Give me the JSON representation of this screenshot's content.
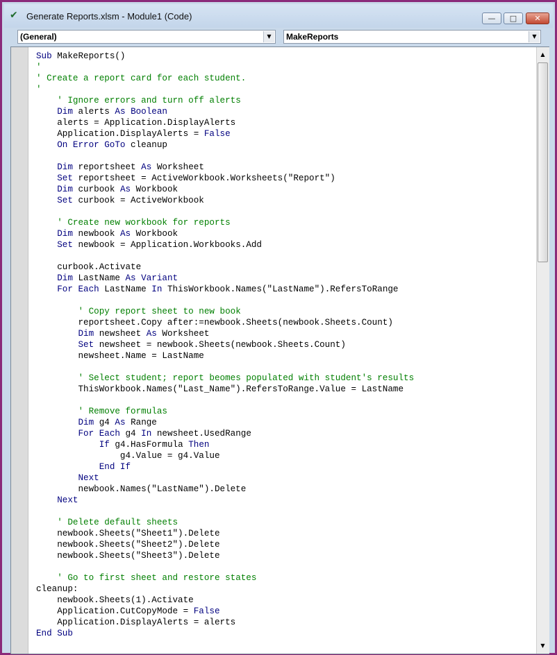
{
  "window": {
    "title": "Generate Reports.xlsm - Module1 (Code)",
    "icon": "excel-vba-icon",
    "controls": {
      "minimize": "—",
      "maximize": "□",
      "close": "✕"
    }
  },
  "object_combo": {
    "value": "(General)",
    "arrow": "▼"
  },
  "procedure_combo": {
    "value": "MakeReports",
    "arrow": "▼"
  },
  "scrollbar": {
    "up": "▲",
    "down": "▼"
  },
  "code_lines": [
    {
      "parts": [
        {
          "t": "kw",
          "s": "Sub"
        },
        {
          "t": "n",
          "s": " MakeReports()"
        }
      ]
    },
    {
      "parts": [
        {
          "t": "cm",
          "s": "'"
        }
      ]
    },
    {
      "parts": [
        {
          "t": "cm",
          "s": "' Create a report card for each student."
        }
      ]
    },
    {
      "parts": [
        {
          "t": "cm",
          "s": "'"
        }
      ]
    },
    {
      "parts": [
        {
          "t": "n",
          "s": "    "
        },
        {
          "t": "cm",
          "s": "' Ignore errors and turn off alerts"
        }
      ]
    },
    {
      "parts": [
        {
          "t": "n",
          "s": "    "
        },
        {
          "t": "kw",
          "s": "Dim"
        },
        {
          "t": "n",
          "s": " alerts "
        },
        {
          "t": "kw",
          "s": "As Boolean"
        }
      ]
    },
    {
      "parts": [
        {
          "t": "n",
          "s": "    alerts = Application.DisplayAlerts"
        }
      ]
    },
    {
      "parts": [
        {
          "t": "n",
          "s": "    Application.DisplayAlerts = "
        },
        {
          "t": "kw",
          "s": "False"
        }
      ]
    },
    {
      "parts": [
        {
          "t": "n",
          "s": "    "
        },
        {
          "t": "kw",
          "s": "On Error GoTo"
        },
        {
          "t": "n",
          "s": " cleanup"
        }
      ]
    },
    {
      "parts": []
    },
    {
      "parts": [
        {
          "t": "n",
          "s": "    "
        },
        {
          "t": "kw",
          "s": "Dim"
        },
        {
          "t": "n",
          "s": " reportsheet "
        },
        {
          "t": "kw",
          "s": "As"
        },
        {
          "t": "n",
          "s": " Worksheet"
        }
      ]
    },
    {
      "parts": [
        {
          "t": "n",
          "s": "    "
        },
        {
          "t": "kw",
          "s": "Set"
        },
        {
          "t": "n",
          "s": " reportsheet = ActiveWorkbook.Worksheets(\"Report\")"
        }
      ]
    },
    {
      "parts": [
        {
          "t": "n",
          "s": "    "
        },
        {
          "t": "kw",
          "s": "Dim"
        },
        {
          "t": "n",
          "s": " curbook "
        },
        {
          "t": "kw",
          "s": "As"
        },
        {
          "t": "n",
          "s": " Workbook"
        }
      ]
    },
    {
      "parts": [
        {
          "t": "n",
          "s": "    "
        },
        {
          "t": "kw",
          "s": "Set"
        },
        {
          "t": "n",
          "s": " curbook = ActiveWorkbook"
        }
      ]
    },
    {
      "parts": []
    },
    {
      "parts": [
        {
          "t": "n",
          "s": "    "
        },
        {
          "t": "cm",
          "s": "' Create new workbook for reports"
        }
      ]
    },
    {
      "parts": [
        {
          "t": "n",
          "s": "    "
        },
        {
          "t": "kw",
          "s": "Dim"
        },
        {
          "t": "n",
          "s": " newbook "
        },
        {
          "t": "kw",
          "s": "As"
        },
        {
          "t": "n",
          "s": " Workbook"
        }
      ]
    },
    {
      "parts": [
        {
          "t": "n",
          "s": "    "
        },
        {
          "t": "kw",
          "s": "Set"
        },
        {
          "t": "n",
          "s": " newbook = Application.Workbooks.Add"
        }
      ]
    },
    {
      "parts": []
    },
    {
      "parts": [
        {
          "t": "n",
          "s": "    curbook.Activate"
        }
      ]
    },
    {
      "parts": [
        {
          "t": "n",
          "s": "    "
        },
        {
          "t": "kw",
          "s": "Dim"
        },
        {
          "t": "n",
          "s": " LastName "
        },
        {
          "t": "kw",
          "s": "As Variant"
        }
      ]
    },
    {
      "parts": [
        {
          "t": "n",
          "s": "    "
        },
        {
          "t": "kw",
          "s": "For Each"
        },
        {
          "t": "n",
          "s": " LastName "
        },
        {
          "t": "kw",
          "s": "In"
        },
        {
          "t": "n",
          "s": " ThisWorkbook.Names(\"LastName\").RefersToRange"
        }
      ]
    },
    {
      "parts": []
    },
    {
      "parts": [
        {
          "t": "n",
          "s": "        "
        },
        {
          "t": "cm",
          "s": "' Copy report sheet to new book"
        }
      ]
    },
    {
      "parts": [
        {
          "t": "n",
          "s": "        reportsheet.Copy after:=newbook.Sheets(newbook.Sheets.Count)"
        }
      ]
    },
    {
      "parts": [
        {
          "t": "n",
          "s": "        "
        },
        {
          "t": "kw",
          "s": "Dim"
        },
        {
          "t": "n",
          "s": " newsheet "
        },
        {
          "t": "kw",
          "s": "As"
        },
        {
          "t": "n",
          "s": " Worksheet"
        }
      ]
    },
    {
      "parts": [
        {
          "t": "n",
          "s": "        "
        },
        {
          "t": "kw",
          "s": "Set"
        },
        {
          "t": "n",
          "s": " newsheet = newbook.Sheets(newbook.Sheets.Count)"
        }
      ]
    },
    {
      "parts": [
        {
          "t": "n",
          "s": "        newsheet.Name = LastName"
        }
      ]
    },
    {
      "parts": []
    },
    {
      "parts": [
        {
          "t": "n",
          "s": "        "
        },
        {
          "t": "cm",
          "s": "' Select student; report beomes populated with student's results"
        }
      ]
    },
    {
      "parts": [
        {
          "t": "n",
          "s": "        ThisWorkbook.Names(\"Last_Name\").RefersToRange.Value = LastName"
        }
      ]
    },
    {
      "parts": []
    },
    {
      "parts": [
        {
          "t": "n",
          "s": "        "
        },
        {
          "t": "cm",
          "s": "' Remove formulas"
        }
      ]
    },
    {
      "parts": [
        {
          "t": "n",
          "s": "        "
        },
        {
          "t": "kw",
          "s": "Dim"
        },
        {
          "t": "n",
          "s": " g4 "
        },
        {
          "t": "kw",
          "s": "As"
        },
        {
          "t": "n",
          "s": " Range"
        }
      ]
    },
    {
      "parts": [
        {
          "t": "n",
          "s": "        "
        },
        {
          "t": "kw",
          "s": "For Each"
        },
        {
          "t": "n",
          "s": " g4 "
        },
        {
          "t": "kw",
          "s": "In"
        },
        {
          "t": "n",
          "s": " newsheet.UsedRange"
        }
      ]
    },
    {
      "parts": [
        {
          "t": "n",
          "s": "            "
        },
        {
          "t": "kw",
          "s": "If"
        },
        {
          "t": "n",
          "s": " g4.HasFormula "
        },
        {
          "t": "kw",
          "s": "Then"
        }
      ]
    },
    {
      "parts": [
        {
          "t": "n",
          "s": "                g4.Value = g4.Value"
        }
      ]
    },
    {
      "parts": [
        {
          "t": "n",
          "s": "            "
        },
        {
          "t": "kw",
          "s": "End If"
        }
      ]
    },
    {
      "parts": [
        {
          "t": "n",
          "s": "        "
        },
        {
          "t": "kw",
          "s": "Next"
        }
      ]
    },
    {
      "parts": [
        {
          "t": "n",
          "s": "        newbook.Names(\"LastName\").Delete"
        }
      ]
    },
    {
      "parts": [
        {
          "t": "n",
          "s": "    "
        },
        {
          "t": "kw",
          "s": "Next"
        }
      ]
    },
    {
      "parts": []
    },
    {
      "parts": [
        {
          "t": "n",
          "s": "    "
        },
        {
          "t": "cm",
          "s": "' Delete default sheets"
        }
      ]
    },
    {
      "parts": [
        {
          "t": "n",
          "s": "    newbook.Sheets(\"Sheet1\").Delete"
        }
      ]
    },
    {
      "parts": [
        {
          "t": "n",
          "s": "    newbook.Sheets(\"Sheet2\").Delete"
        }
      ]
    },
    {
      "parts": [
        {
          "t": "n",
          "s": "    newbook.Sheets(\"Sheet3\").Delete"
        }
      ]
    },
    {
      "parts": []
    },
    {
      "parts": [
        {
          "t": "n",
          "s": "    "
        },
        {
          "t": "cm",
          "s": "' Go to first sheet and restore states"
        }
      ]
    },
    {
      "parts": [
        {
          "t": "n",
          "s": "cleanup:"
        }
      ]
    },
    {
      "parts": [
        {
          "t": "n",
          "s": "    newbook.Sheets(1).Activate"
        }
      ]
    },
    {
      "parts": [
        {
          "t": "n",
          "s": "    Application.CutCopyMode = "
        },
        {
          "t": "kw",
          "s": "False"
        }
      ]
    },
    {
      "parts": [
        {
          "t": "n",
          "s": "    Application.DisplayAlerts = alerts"
        }
      ]
    },
    {
      "parts": [
        {
          "t": "kw",
          "s": "End Sub"
        }
      ]
    }
  ],
  "colors": {
    "keyword": "#00007f",
    "comment": "#007f00",
    "text": "#000000",
    "frame": "#8a2a7a"
  }
}
